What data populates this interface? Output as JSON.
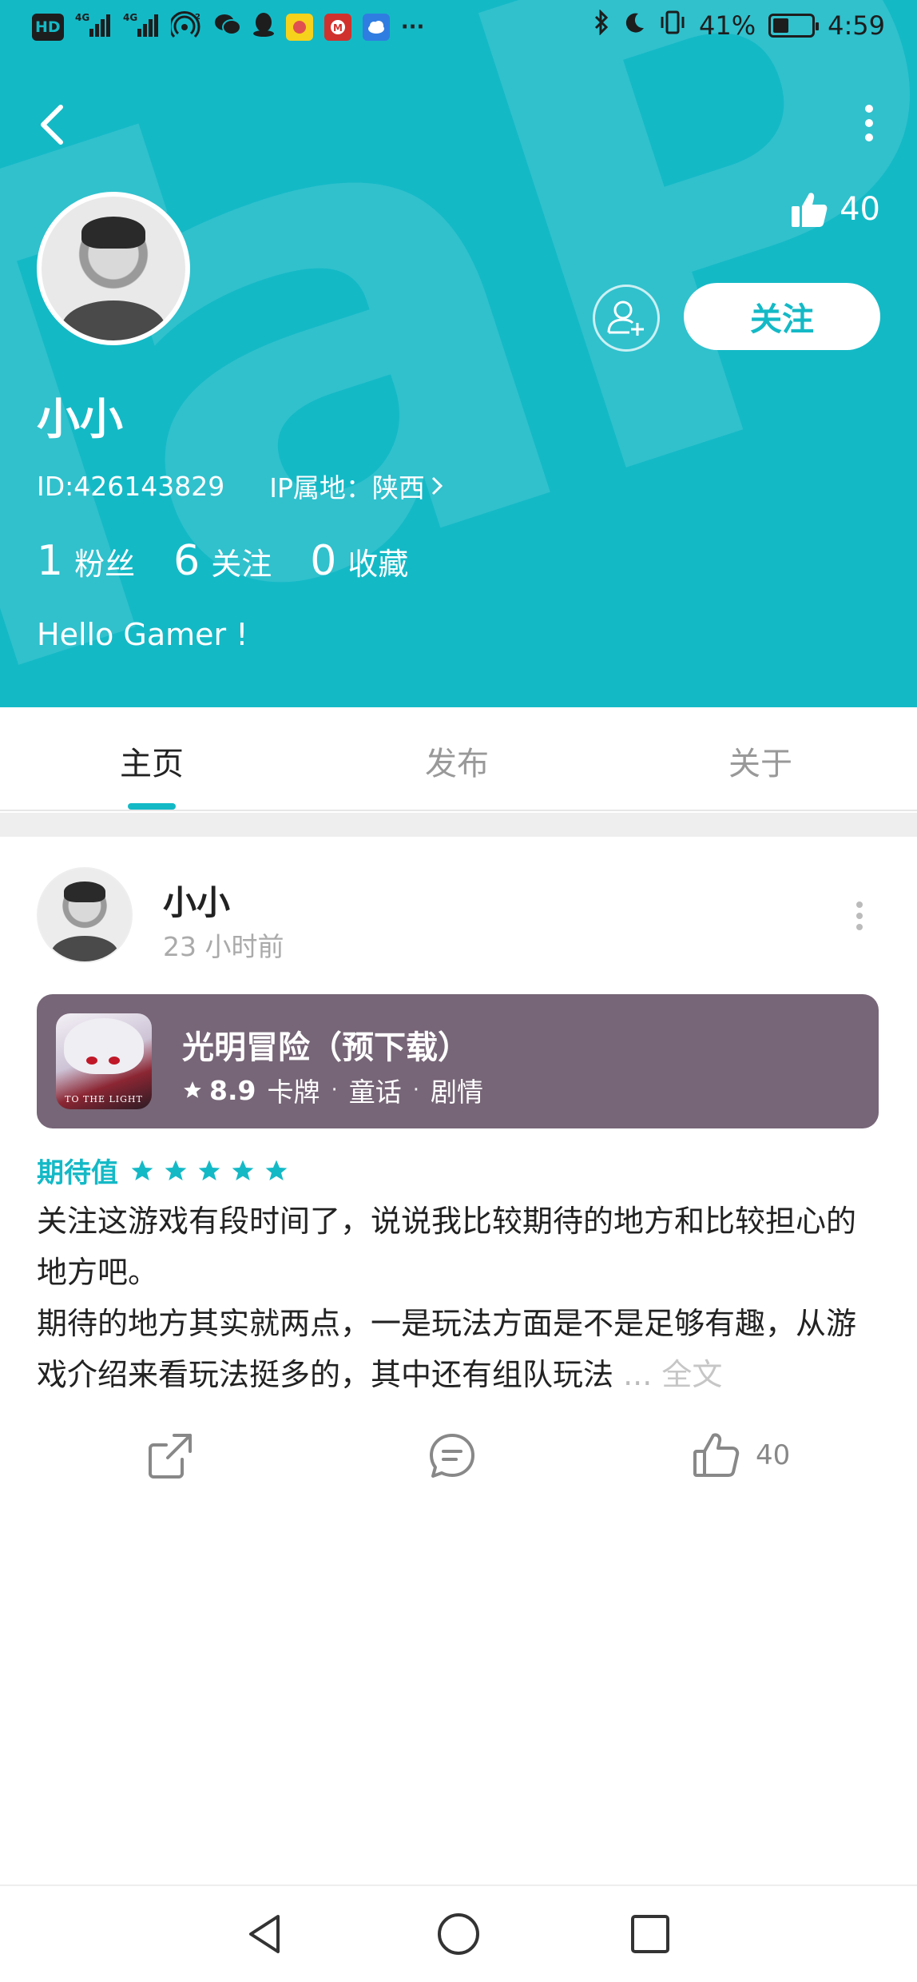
{
  "status_bar": {
    "left_chips": [
      "HD",
      "4G",
      "4G",
      "2"
    ],
    "battery_percent": "41%",
    "battery_level": 0.41,
    "time": "4:59"
  },
  "header": {
    "watermark": "pTaP",
    "likes": "40",
    "follow_label": "关注",
    "username": "小小",
    "id_text": "ID:426143829",
    "ip_text": "IP属地：陕西",
    "stats": [
      {
        "num": "1",
        "label": "粉丝"
      },
      {
        "num": "6",
        "label": "关注"
      },
      {
        "num": "0",
        "label": "收藏"
      }
    ],
    "bio": "Hello Gamer !"
  },
  "tabs": [
    {
      "label": "主页",
      "active": true
    },
    {
      "label": "发布",
      "active": false
    },
    {
      "label": "关于",
      "active": false
    }
  ],
  "post": {
    "author": "小小",
    "time": "23 小时前",
    "game": {
      "title": "光明冒险（预下载）",
      "rating": "8.9",
      "tags": [
        "卡牌",
        "童话",
        "剧情"
      ],
      "icon_text": "TO THE LIGHT"
    },
    "expect_label": "期待值",
    "expect_stars": 5,
    "body_lines": [
      "关注这游戏有段时间了，说说我比较期待的地方和比较担心的地方吧。",
      "期待的地方其实就两点，一是玩法方面是不是足够有趣，从游戏介绍来看玩法挺多的，其中还有组队玩法"
    ],
    "ellipsis": " ...",
    "full_text_label": " 全文",
    "like_count": "40"
  },
  "colors": {
    "accent": "#14b9c6",
    "card_bg": "#776677",
    "muted": "#999999"
  }
}
